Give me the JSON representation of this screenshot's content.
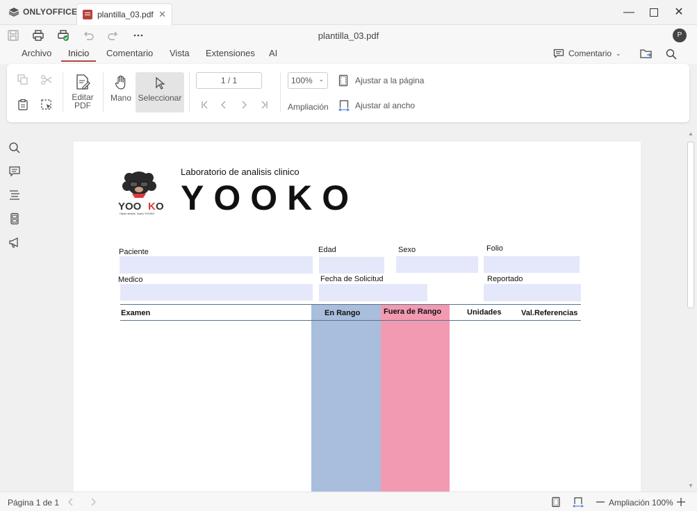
{
  "app": {
    "brand": "ONLYOFFICE"
  },
  "tab": {
    "title": "plantilla_03.pdf"
  },
  "document": {
    "title": "plantilla_03.pdf"
  },
  "user": {
    "initial": "P"
  },
  "menu": {
    "items": [
      "Archivo",
      "Inicio",
      "Comentario",
      "Vista",
      "Extensiones",
      "AI"
    ],
    "active": "Inicio",
    "comment_button": "Comentario"
  },
  "ribbon": {
    "edit_pdf": [
      "Editar",
      "PDF"
    ],
    "hand": "Mano",
    "select": "Seleccionar",
    "page_value": "1 / 1",
    "zoom_value": "100%",
    "zoom_label": "Ampliación",
    "fit_page": "Ajustar a la página",
    "fit_width": "Ajustar al ancho"
  },
  "pdf": {
    "logo_text": "YOOKO",
    "logo_tagline": "Hazlo simple, hazlo YOOKO",
    "subtitle": "Laboratorio de analisis clinico",
    "title": "YOOKO",
    "fields": {
      "paciente": "Paciente",
      "edad": "Edad",
      "sexo": "Sexo",
      "folio": "Folio",
      "medico": "Medico",
      "fecha": "Fecha de Solicitud",
      "reportado": "Reportado"
    },
    "table_headers": [
      "Examen",
      "En Rango",
      "Fuera de Rango",
      "Unidades",
      "Val.Referencias"
    ]
  },
  "status": {
    "page": "Página 1 de 1",
    "zoom": "Ampliación 100%"
  },
  "colors": {
    "accent": "#b7433d",
    "field_bg": "#e5e8fb",
    "in_range": "#a9bedd",
    "out_range": "#f39ab3"
  }
}
